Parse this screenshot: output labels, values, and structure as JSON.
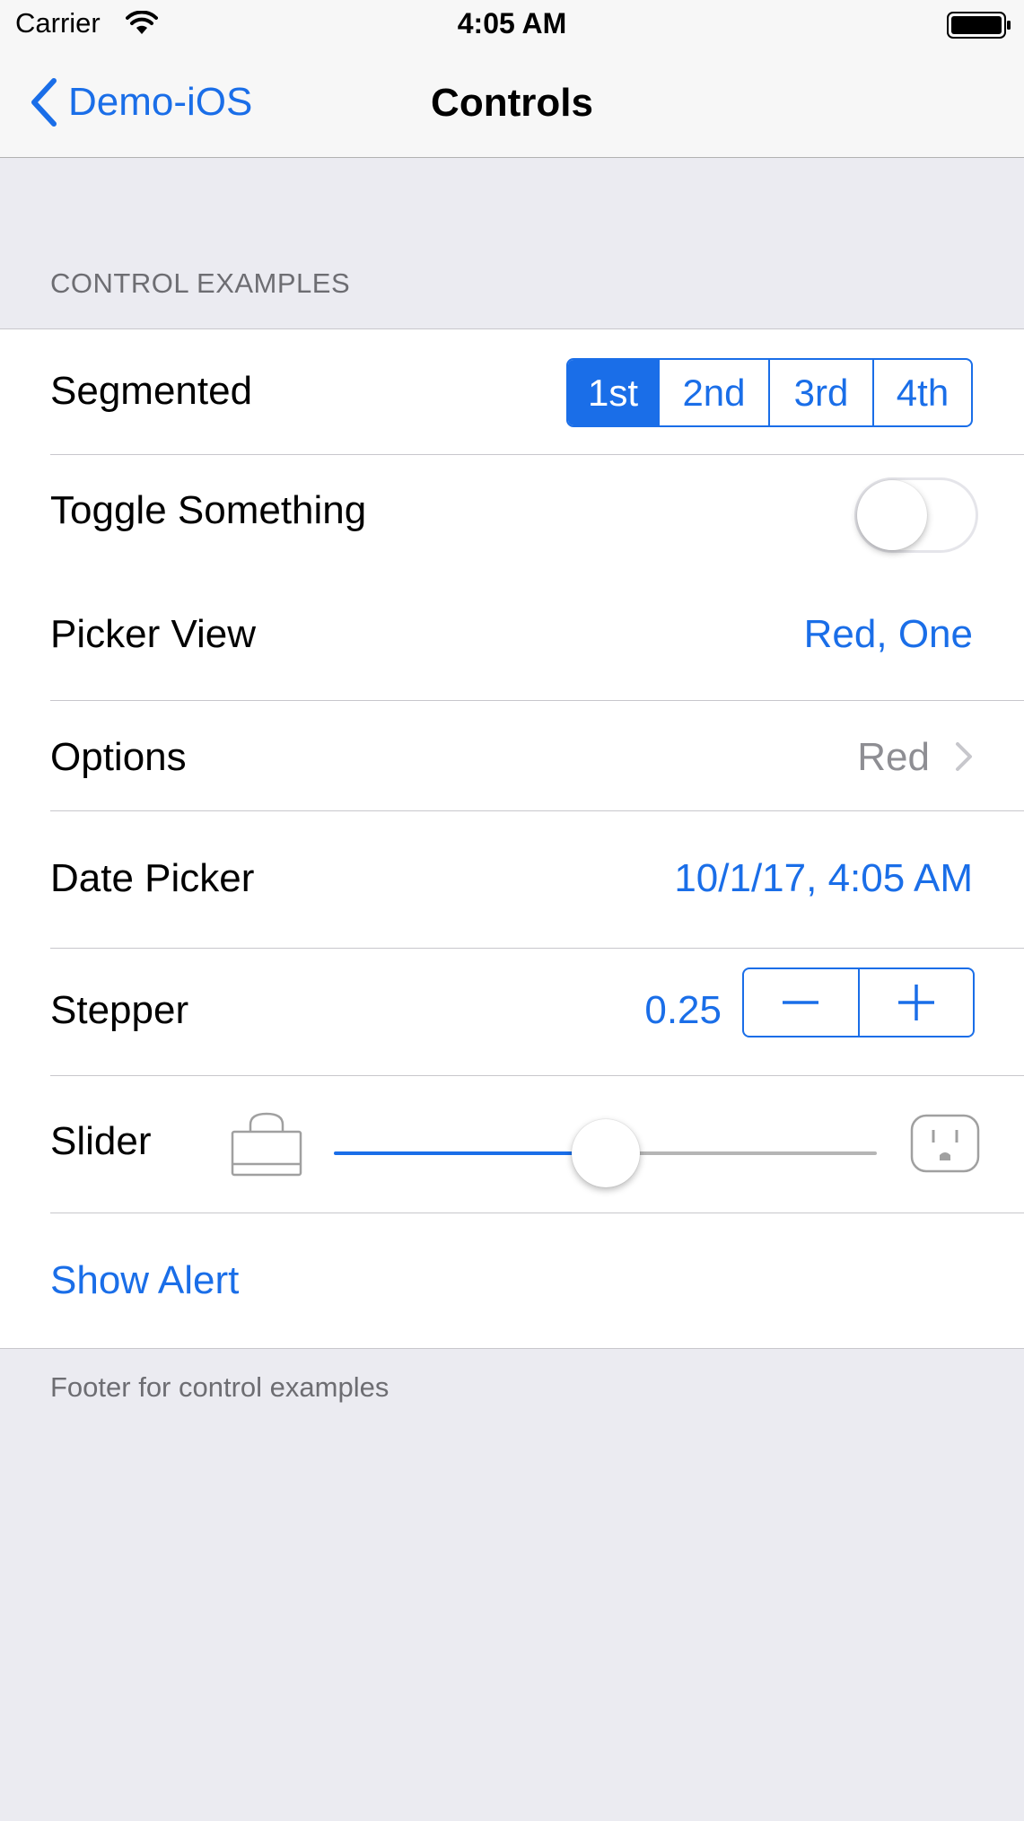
{
  "status_bar": {
    "carrier": "Carrier",
    "time": "4:05 AM",
    "wifi_icon": "wifi-icon",
    "battery_icon": "battery-icon"
  },
  "nav": {
    "back_label": "Demo-iOS",
    "title": "Controls"
  },
  "section": {
    "header": "CONTROL EXAMPLES",
    "footer": "Footer for control examples"
  },
  "rows": {
    "segmented": {
      "label": "Segmented",
      "segments": [
        "1st",
        "2nd",
        "3rd",
        "4th"
      ],
      "selected": "1st"
    },
    "toggle": {
      "label": "Toggle Something",
      "on": false
    },
    "picker": {
      "label": "Picker View",
      "value": "Red, One"
    },
    "options": {
      "label": "Options",
      "value": "Red"
    },
    "date": {
      "label": "Date Picker",
      "value": "10/1/17, 4:05 AM"
    },
    "stepper": {
      "label": "Stepper",
      "value": "0.25"
    },
    "slider": {
      "label": "Slider",
      "value_fraction": 0.5,
      "min_icon": "bag-icon",
      "max_icon": "outlet-icon"
    },
    "alert": {
      "label": "Show Alert"
    }
  },
  "colors": {
    "accent": "#1a6ee8",
    "background": "#ebebf1",
    "separator": "#c8c7cc"
  }
}
